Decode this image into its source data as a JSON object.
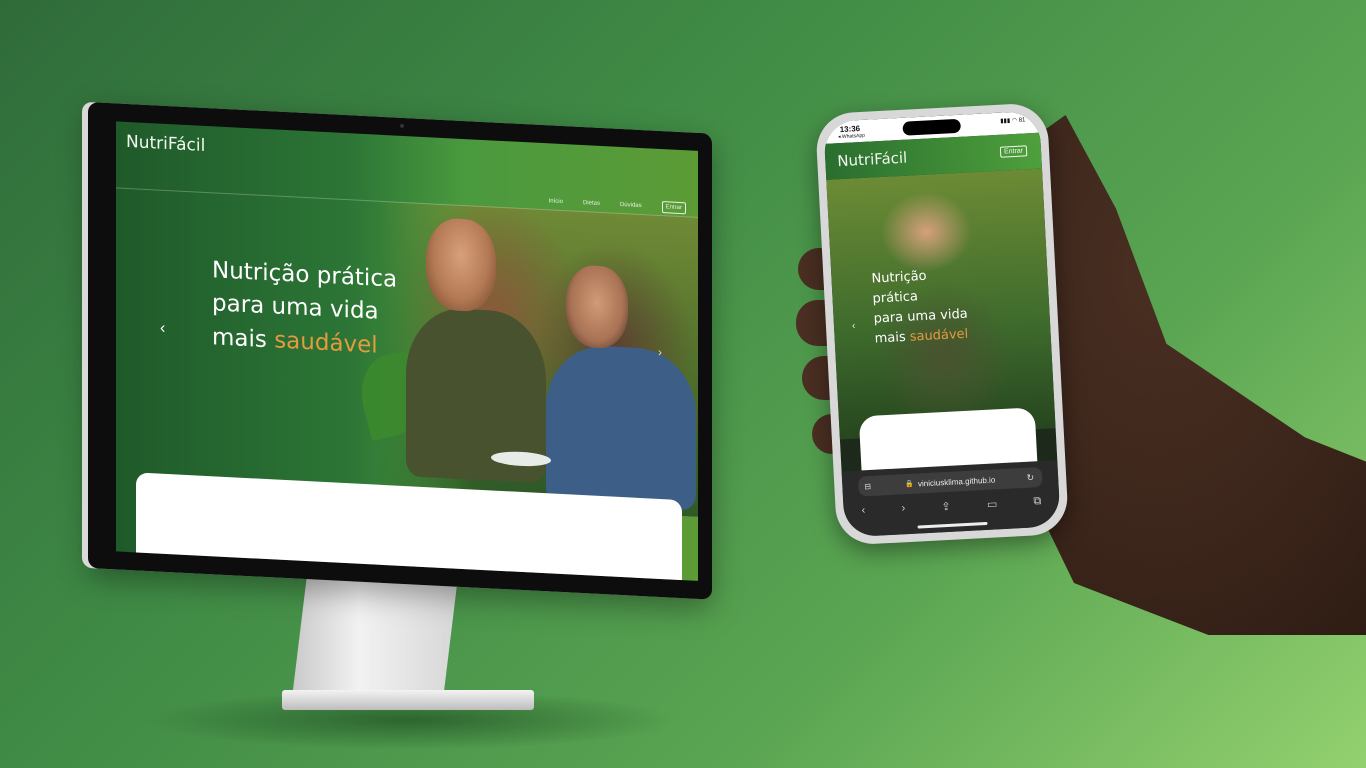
{
  "desktop": {
    "brand": "NutriFácil",
    "nav": [
      "Início",
      "Dietas",
      "Dúvidas"
    ],
    "enter_label": "Entrar",
    "hero": {
      "line1": "Nutrição prática",
      "line2": "para uma vida",
      "line3_prefix": "mais ",
      "line3_accent": "saudável"
    },
    "prev_icon": "chevron-left-icon",
    "next_icon": "chevron-right-icon"
  },
  "phone": {
    "status": {
      "time": "13:36",
      "back_app": "◂ WhatsApp",
      "icons": "▮▮▮ ◠ 81"
    },
    "brand": "NutriFácil",
    "enter_label": "Entrar",
    "hero": {
      "line1": "Nutrição",
      "line2": "prática",
      "line3": "para uma vida",
      "line4_prefix": "mais ",
      "line4_accent": "saudável"
    },
    "url": "viniciusklima.github.io"
  },
  "colors": {
    "accent": "#e59a3e",
    "brand_green": "#2c7536",
    "background": "#4a9448"
  }
}
